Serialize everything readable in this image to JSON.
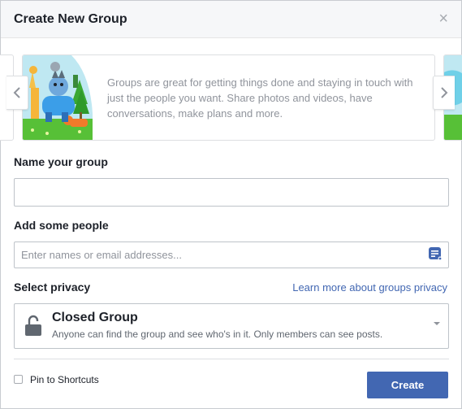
{
  "dialog": {
    "title": "Create New Group",
    "close_symbol": "×"
  },
  "carousel": {
    "description": "Groups are great for getting things done and staying in touch with just the people you want. Share photos and videos, have conversations, make plans and more.",
    "illustration": "animals-group-illustration"
  },
  "form": {
    "name_label": "Name your group",
    "name_value": "",
    "people_label": "Add some people",
    "people_placeholder": "Enter names or email addresses...",
    "privacy_label": "Select privacy",
    "privacy_link": "Learn more about groups privacy",
    "privacy_selected": {
      "title": "Closed Group",
      "description": "Anyone can find the group and see who's in it. Only members can see posts."
    }
  },
  "footer": {
    "pin_label": "Pin to Shortcuts",
    "pin_checked": false,
    "create_label": "Create"
  },
  "colors": {
    "accent": "#4267b2",
    "border": "#bec3c9",
    "muted_text": "#90949c"
  }
}
